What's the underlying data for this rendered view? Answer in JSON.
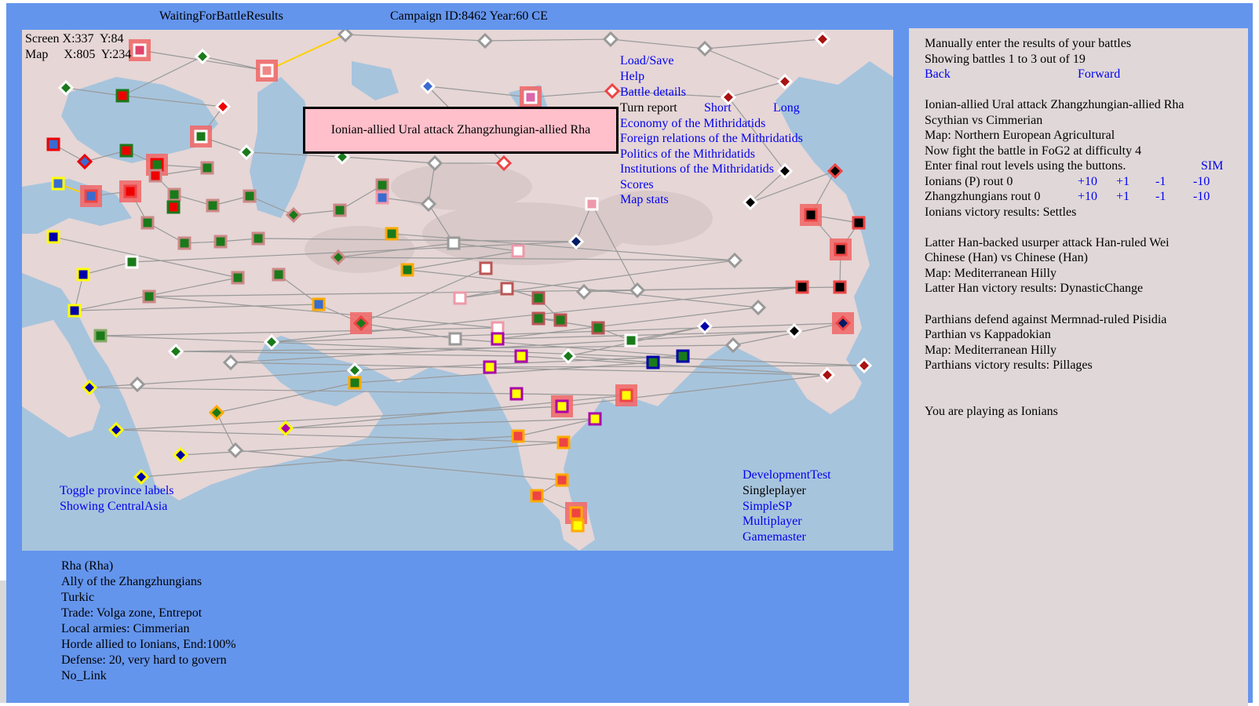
{
  "header": {
    "status": "WaitingForBattleResults",
    "campaign": "Campaign ID:8462 Year:60 CE"
  },
  "coords": {
    "screen": "Screen X:337  Y:84",
    "map": "Map     X:805  Y:234"
  },
  "menu": {
    "load_save": "Load/Save",
    "help": "Help",
    "battle_details": "Battle details",
    "turn_report": "Turn report",
    "short": "Short",
    "long": "Long",
    "economy": "Economy of the Mithridatids",
    "foreign": "Foreign relations of the Mithridatids",
    "politics": "Politics of the Mithridatids",
    "institutions": "Institutions of the Mithridatids",
    "scores": "Scores",
    "map_stats": "Map stats"
  },
  "battle_popup": "Ionian-allied Ural attack Zhangzhungian-allied Rha",
  "map_labels": {
    "toggle": "Toggle province labels",
    "showing": "Showing CentralAsia"
  },
  "modes": {
    "dev": "DevelopmentTest",
    "single": "Singleplayer",
    "simple": "SimpleSP",
    "multi": "Multiplayer",
    "gm": "Gamemaster"
  },
  "province": {
    "line1": "Rha (Rha)",
    "line2": "Ally of the Zhangzhungians",
    "line3": "Turkic",
    "line4": "Trade: Volga zone, Entrepot",
    "line5": "Local armies: Cimmerian",
    "line6": "Horde allied to Ionians, End:100%",
    "line7": "Defense: 20, very hard to govern",
    "line8": "No_Link"
  },
  "panel": {
    "intro1": "Manually enter the results of your battles",
    "intro2": "Showing battles 1 to 3 out of 19",
    "back": "Back",
    "forward": "Forward",
    "b1_title": "Ionian-allied Ural attack Zhangzhungian-allied Rha",
    "b1_sides": "Scythian vs Cimmerian",
    "b1_map": "Map: Northern European Agricultural",
    "b1_fight": "Now fight the battle in FoG2 at difficulty 4",
    "b1_enter": "Enter final rout levels using the buttons.",
    "sim": "SIM",
    "b1_row1": "Ionians (P) rout 0",
    "b1_row2": "Zhangzhungians rout 0",
    "btn_p10": "+10",
    "btn_p1": "+1",
    "btn_m1": "-1",
    "btn_m10": "-10",
    "b1_result": "Ionians victory results: Settles",
    "b2_title": "Latter Han-backed usurper attack Han-ruled Wei",
    "b2_sides": "Chinese (Han) vs Chinese (Han)",
    "b2_map": "Map: Mediterranean Hilly",
    "b2_result": "Latter Han victory results: DynasticChange",
    "b3_title": "Parthians defend against Mermnad-ruled Pisidia",
    "b3_sides": "Parthian vs Kappadokian",
    "b3_map": "Map: Mediterranean Hilly",
    "b3_result": "Parthians victory results: Pillages",
    "playing": "You are playing as Ionians"
  }
}
